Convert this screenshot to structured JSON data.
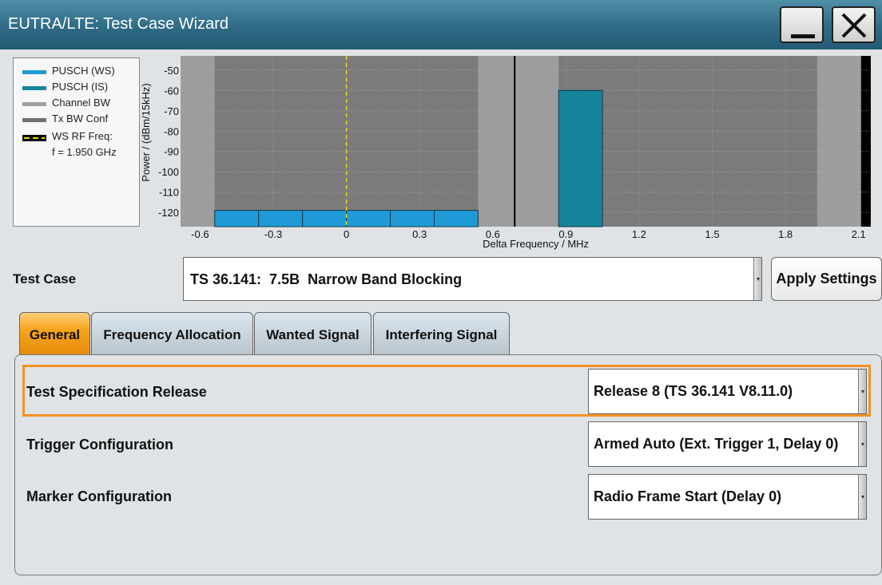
{
  "window": {
    "title": "EUTRA/LTE: Test Case Wizard",
    "controls": [
      "minimize-icon",
      "close-icon"
    ]
  },
  "legend": {
    "items": [
      {
        "label": "PUSCH (WS)",
        "color": "#1f9ad6",
        "style": "solid"
      },
      {
        "label": "PUSCH (IS)",
        "color": "#15849c",
        "style": "solid"
      },
      {
        "label": "Channel BW",
        "color": "#a0a0a0",
        "style": "solid"
      },
      {
        "label": "Tx BW Conf",
        "color": "#707070",
        "style": "solid"
      },
      {
        "label": "WS RF Freq:",
        "color": "#e8d80a",
        "style": "dashed"
      }
    ],
    "freq_note": "f = 1.950 GHz"
  },
  "chart_data": {
    "type": "bar",
    "xlabel": "Delta Frequency / MHz",
    "ylabel": "Power / (dBm/15kHz)",
    "xlim": [
      -0.68,
      2.15
    ],
    "ylim": [
      -127,
      -43
    ],
    "x_ticks": [
      "-0.6",
      "-0.3",
      "0",
      "0.3",
      "0.6",
      "0.9",
      "1.2",
      "1.5",
      "1.8",
      "2.1"
    ],
    "x_tick_values": [
      -0.6,
      -0.3,
      0,
      0.3,
      0.6,
      0.9,
      1.2,
      1.5,
      1.8,
      2.1
    ],
    "y_ticks": [
      "-50",
      "-60",
      "-70",
      "-80",
      "-90",
      "-100",
      "-110",
      "-120"
    ],
    "y_tick_values": [
      -50,
      -60,
      -70,
      -80,
      -90,
      -100,
      -110,
      -120
    ],
    "regions": [
      {
        "name": "channel-bw",
        "from": -0.72,
        "to": 0.72,
        "color": "#9d9d9d"
      },
      {
        "name": "tx-bw-conf",
        "from": -0.54,
        "to": 0.54,
        "color": "#7b7b7b"
      },
      {
        "name": "interferer-channel-bw",
        "from": 0.69,
        "to": 2.11,
        "color": "#9d9d9d"
      },
      {
        "name": "interferer-tx-bw-conf",
        "from": 0.87,
        "to": 1.93,
        "color": "#7b7b7b"
      }
    ],
    "series": [
      {
        "name": "PUSCH (WS)",
        "color": "#1f9ad6",
        "bars": [
          {
            "x0": -0.54,
            "x1": -0.36,
            "y": -119
          },
          {
            "x0": -0.36,
            "x1": -0.18,
            "y": -119
          },
          {
            "x0": -0.18,
            "x1": 0.0,
            "y": -119
          },
          {
            "x0": 0.0,
            "x1": 0.18,
            "y": -119
          },
          {
            "x0": 0.18,
            "x1": 0.36,
            "y": -119
          },
          {
            "x0": 0.36,
            "x1": 0.54,
            "y": -119
          }
        ]
      },
      {
        "name": "PUSCH (IS)",
        "color": "#15849c",
        "bars": [
          {
            "x0": 0.87,
            "x1": 1.05,
            "y": -60
          }
        ]
      }
    ],
    "markers": [
      {
        "name": "WS RF Freq",
        "x": 0.0,
        "style": "dashed",
        "color": "#e8d80a"
      },
      {
        "name": "band edge",
        "x": 0.69,
        "style": "solid",
        "color": "#000000"
      }
    ],
    "grid": true
  },
  "test_case": {
    "label": "Test Case",
    "value": "TS 36.141:  7.5B  Narrow Band Blocking",
    "apply_label": "Apply Settings"
  },
  "tabs": [
    {
      "label": "General",
      "active": true
    },
    {
      "label": "Frequency Allocation",
      "active": false
    },
    {
      "label": "Wanted Signal",
      "active": false
    },
    {
      "label": "Interfering Signal",
      "active": false
    }
  ],
  "general": {
    "rows": [
      {
        "label": "Test Specification Release",
        "value": "Release 8 (TS 36.141 V8.11.0)"
      },
      {
        "label": "Trigger Configuration",
        "value": "Armed Auto (Ext. Trigger 1, Delay 0)"
      },
      {
        "label": "Marker Configuration",
        "value": "Radio Frame Start (Delay 0)"
      }
    ]
  }
}
